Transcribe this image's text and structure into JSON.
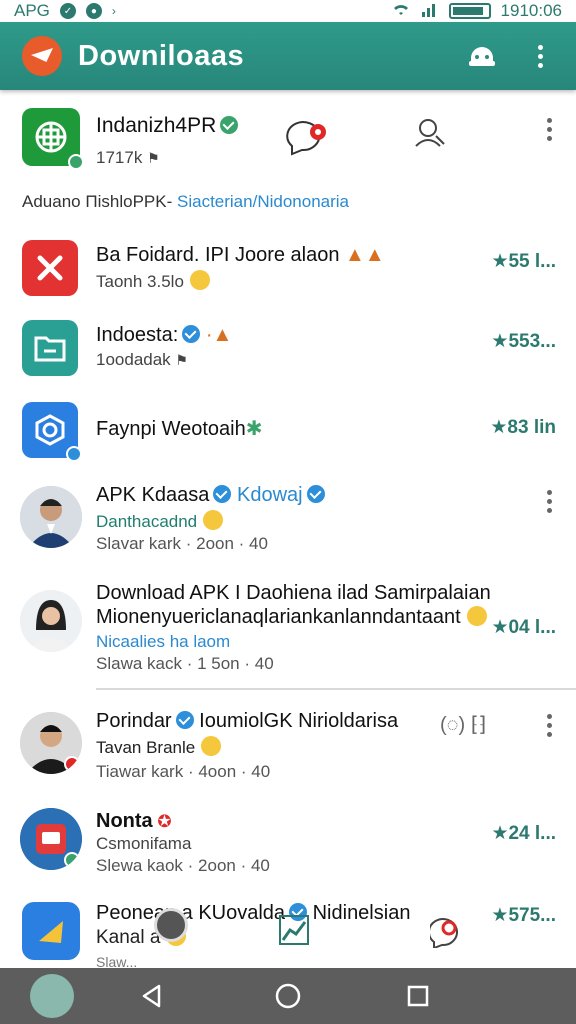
{
  "status_bar": {
    "left_text": "APG",
    "time": "1910:06"
  },
  "app_bar": {
    "title": "Downiloaas"
  },
  "featured": {
    "title": "Indanizh4PR",
    "meta": "1717k",
    "section_label": "Aduano ΠishloPPK-",
    "section_link": "Siacterian/Nidononaria"
  },
  "items": [
    {
      "title": "Ba Foidard. IPI Joore alaon",
      "sub": "Taonh 3.5lo",
      "rating": "★55 l..."
    },
    {
      "title": "Indoesta:",
      "sub": "1oodadak",
      "rating": "★553..."
    },
    {
      "title": "Faynpi Weotoaih",
      "sub": "",
      "rating": "★83 lin"
    },
    {
      "title": "APK Kdaasa",
      "title_extra": "Kdowaj",
      "sub": "Danthacadnd",
      "meta": "Slavar kark · 2oon · 40"
    },
    {
      "title": "Download APK I Daohiena ilad Samirpalaian",
      "title2": "Mionenyuericlanaqlariankanlanndantaant",
      "sub": "Nicaalies ha laom",
      "meta": "Slawa kack · 1 5on · 40",
      "rating": "★04 l..."
    },
    {
      "title": "Porindar",
      "title_extra": "IoumiolGK Nirioldarisa",
      "sub": "Tavan Branle",
      "meta": "Tiawar kark · 4oon · 40"
    },
    {
      "title": "Nonta",
      "sub": "Csmonifama",
      "meta": "Slewa kaok · 2oon · 40",
      "rating": "★24 l..."
    },
    {
      "title": "Peonean a KUovalda",
      "title_extra": "Nidinelsian",
      "sub": "Kanal a",
      "meta": "Slaw...",
      "rating": "★575..."
    }
  ]
}
